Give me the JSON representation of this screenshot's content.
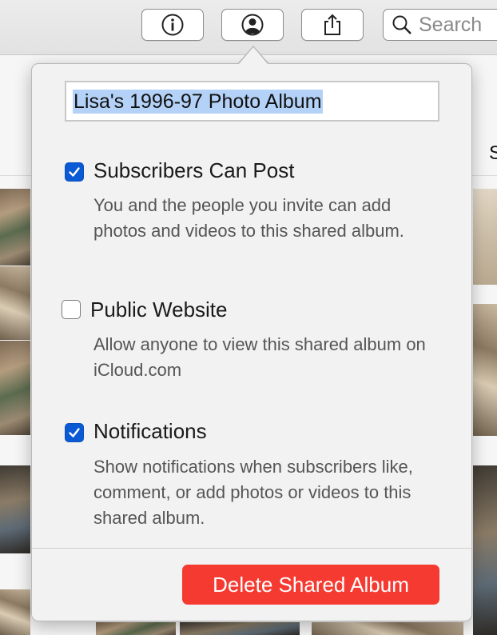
{
  "toolbar": {
    "info_icon": "info-icon",
    "people_icon": "person-circle-icon",
    "share_icon": "share-icon",
    "search_placeholder": "Search",
    "edge_letter": "S"
  },
  "popover": {
    "album_title": "Lisa's 1996-97 Photo Album",
    "options": [
      {
        "label": "Subscribers Can Post",
        "checked": true,
        "description": "You and the people you invite can add photos and videos to this shared album."
      },
      {
        "label": "Public Website",
        "checked": false,
        "description": "Allow anyone to view this shared album on iCloud.com"
      },
      {
        "label": "Notifications",
        "checked": true,
        "description": "Show notifications when subscribers like, comment, or add photos or videos to this shared album."
      }
    ],
    "delete_label": "Delete Shared Album",
    "colors": {
      "checkbox_on": "#0a5ad4",
      "delete_button": "#f53b31",
      "selection": "#b4d2f7"
    }
  }
}
